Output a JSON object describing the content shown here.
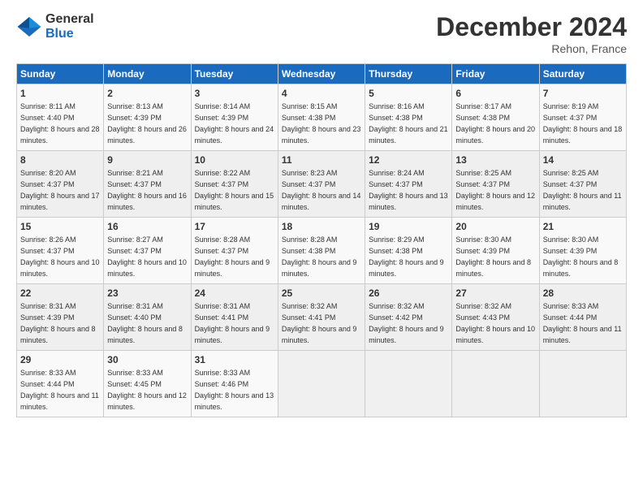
{
  "header": {
    "logo_general": "General",
    "logo_blue": "Blue",
    "title": "December 2024",
    "location": "Rehon, France"
  },
  "columns": [
    "Sunday",
    "Monday",
    "Tuesday",
    "Wednesday",
    "Thursday",
    "Friday",
    "Saturday"
  ],
  "rows": [
    [
      {
        "day": "1",
        "sunrise": "Sunrise: 8:11 AM",
        "sunset": "Sunset: 4:40 PM",
        "daylight": "Daylight: 8 hours and 28 minutes."
      },
      {
        "day": "2",
        "sunrise": "Sunrise: 8:13 AM",
        "sunset": "Sunset: 4:39 PM",
        "daylight": "Daylight: 8 hours and 26 minutes."
      },
      {
        "day": "3",
        "sunrise": "Sunrise: 8:14 AM",
        "sunset": "Sunset: 4:39 PM",
        "daylight": "Daylight: 8 hours and 24 minutes."
      },
      {
        "day": "4",
        "sunrise": "Sunrise: 8:15 AM",
        "sunset": "Sunset: 4:38 PM",
        "daylight": "Daylight: 8 hours and 23 minutes."
      },
      {
        "day": "5",
        "sunrise": "Sunrise: 8:16 AM",
        "sunset": "Sunset: 4:38 PM",
        "daylight": "Daylight: 8 hours and 21 minutes."
      },
      {
        "day": "6",
        "sunrise": "Sunrise: 8:17 AM",
        "sunset": "Sunset: 4:38 PM",
        "daylight": "Daylight: 8 hours and 20 minutes."
      },
      {
        "day": "7",
        "sunrise": "Sunrise: 8:19 AM",
        "sunset": "Sunset: 4:37 PM",
        "daylight": "Daylight: 8 hours and 18 minutes."
      }
    ],
    [
      {
        "day": "8",
        "sunrise": "Sunrise: 8:20 AM",
        "sunset": "Sunset: 4:37 PM",
        "daylight": "Daylight: 8 hours and 17 minutes."
      },
      {
        "day": "9",
        "sunrise": "Sunrise: 8:21 AM",
        "sunset": "Sunset: 4:37 PM",
        "daylight": "Daylight: 8 hours and 16 minutes."
      },
      {
        "day": "10",
        "sunrise": "Sunrise: 8:22 AM",
        "sunset": "Sunset: 4:37 PM",
        "daylight": "Daylight: 8 hours and 15 minutes."
      },
      {
        "day": "11",
        "sunrise": "Sunrise: 8:23 AM",
        "sunset": "Sunset: 4:37 PM",
        "daylight": "Daylight: 8 hours and 14 minutes."
      },
      {
        "day": "12",
        "sunrise": "Sunrise: 8:24 AM",
        "sunset": "Sunset: 4:37 PM",
        "daylight": "Daylight: 8 hours and 13 minutes."
      },
      {
        "day": "13",
        "sunrise": "Sunrise: 8:25 AM",
        "sunset": "Sunset: 4:37 PM",
        "daylight": "Daylight: 8 hours and 12 minutes."
      },
      {
        "day": "14",
        "sunrise": "Sunrise: 8:25 AM",
        "sunset": "Sunset: 4:37 PM",
        "daylight": "Daylight: 8 hours and 11 minutes."
      }
    ],
    [
      {
        "day": "15",
        "sunrise": "Sunrise: 8:26 AM",
        "sunset": "Sunset: 4:37 PM",
        "daylight": "Daylight: 8 hours and 10 minutes."
      },
      {
        "day": "16",
        "sunrise": "Sunrise: 8:27 AM",
        "sunset": "Sunset: 4:37 PM",
        "daylight": "Daylight: 8 hours and 10 minutes."
      },
      {
        "day": "17",
        "sunrise": "Sunrise: 8:28 AM",
        "sunset": "Sunset: 4:37 PM",
        "daylight": "Daylight: 8 hours and 9 minutes."
      },
      {
        "day": "18",
        "sunrise": "Sunrise: 8:28 AM",
        "sunset": "Sunset: 4:38 PM",
        "daylight": "Daylight: 8 hours and 9 minutes."
      },
      {
        "day": "19",
        "sunrise": "Sunrise: 8:29 AM",
        "sunset": "Sunset: 4:38 PM",
        "daylight": "Daylight: 8 hours and 9 minutes."
      },
      {
        "day": "20",
        "sunrise": "Sunrise: 8:30 AM",
        "sunset": "Sunset: 4:39 PM",
        "daylight": "Daylight: 8 hours and 8 minutes."
      },
      {
        "day": "21",
        "sunrise": "Sunrise: 8:30 AM",
        "sunset": "Sunset: 4:39 PM",
        "daylight": "Daylight: 8 hours and 8 minutes."
      }
    ],
    [
      {
        "day": "22",
        "sunrise": "Sunrise: 8:31 AM",
        "sunset": "Sunset: 4:39 PM",
        "daylight": "Daylight: 8 hours and 8 minutes."
      },
      {
        "day": "23",
        "sunrise": "Sunrise: 8:31 AM",
        "sunset": "Sunset: 4:40 PM",
        "daylight": "Daylight: 8 hours and 8 minutes."
      },
      {
        "day": "24",
        "sunrise": "Sunrise: 8:31 AM",
        "sunset": "Sunset: 4:41 PM",
        "daylight": "Daylight: 8 hours and 9 minutes."
      },
      {
        "day": "25",
        "sunrise": "Sunrise: 8:32 AM",
        "sunset": "Sunset: 4:41 PM",
        "daylight": "Daylight: 8 hours and 9 minutes."
      },
      {
        "day": "26",
        "sunrise": "Sunrise: 8:32 AM",
        "sunset": "Sunset: 4:42 PM",
        "daylight": "Daylight: 8 hours and 9 minutes."
      },
      {
        "day": "27",
        "sunrise": "Sunrise: 8:32 AM",
        "sunset": "Sunset: 4:43 PM",
        "daylight": "Daylight: 8 hours and 10 minutes."
      },
      {
        "day": "28",
        "sunrise": "Sunrise: 8:33 AM",
        "sunset": "Sunset: 4:44 PM",
        "daylight": "Daylight: 8 hours and 11 minutes."
      }
    ],
    [
      {
        "day": "29",
        "sunrise": "Sunrise: 8:33 AM",
        "sunset": "Sunset: 4:44 PM",
        "daylight": "Daylight: 8 hours and 11 minutes."
      },
      {
        "day": "30",
        "sunrise": "Sunrise: 8:33 AM",
        "sunset": "Sunset: 4:45 PM",
        "daylight": "Daylight: 8 hours and 12 minutes."
      },
      {
        "day": "31",
        "sunrise": "Sunrise: 8:33 AM",
        "sunset": "Sunset: 4:46 PM",
        "daylight": "Daylight: 8 hours and 13 minutes."
      },
      null,
      null,
      null,
      null
    ]
  ]
}
